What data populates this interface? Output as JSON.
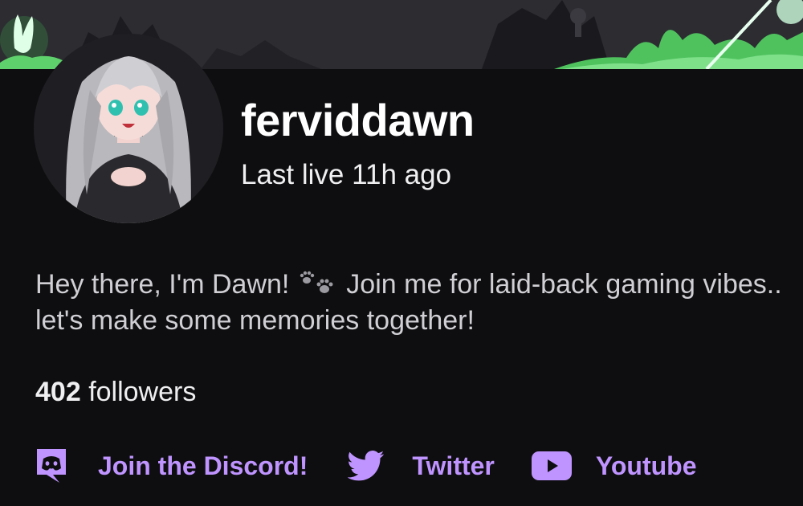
{
  "channel": {
    "username": "ferviddawn",
    "last_live": "Last live 11h ago"
  },
  "bio": {
    "part1": "Hey there, I'm Dawn!",
    "part2": "Join me for laid-back gaming vibes.. let's make some memories together!"
  },
  "followers": {
    "count": "402",
    "label": "followers"
  },
  "socials": [
    {
      "label": "Join the Discord!",
      "icon": "discord-icon"
    },
    {
      "label": "Twitter",
      "icon": "twitter-icon"
    },
    {
      "label": "Youtube",
      "icon": "youtube-icon"
    }
  ],
  "colors": {
    "background": "#0e0e10",
    "accent": "#bf94ff",
    "banner_green": "#62d26f"
  }
}
